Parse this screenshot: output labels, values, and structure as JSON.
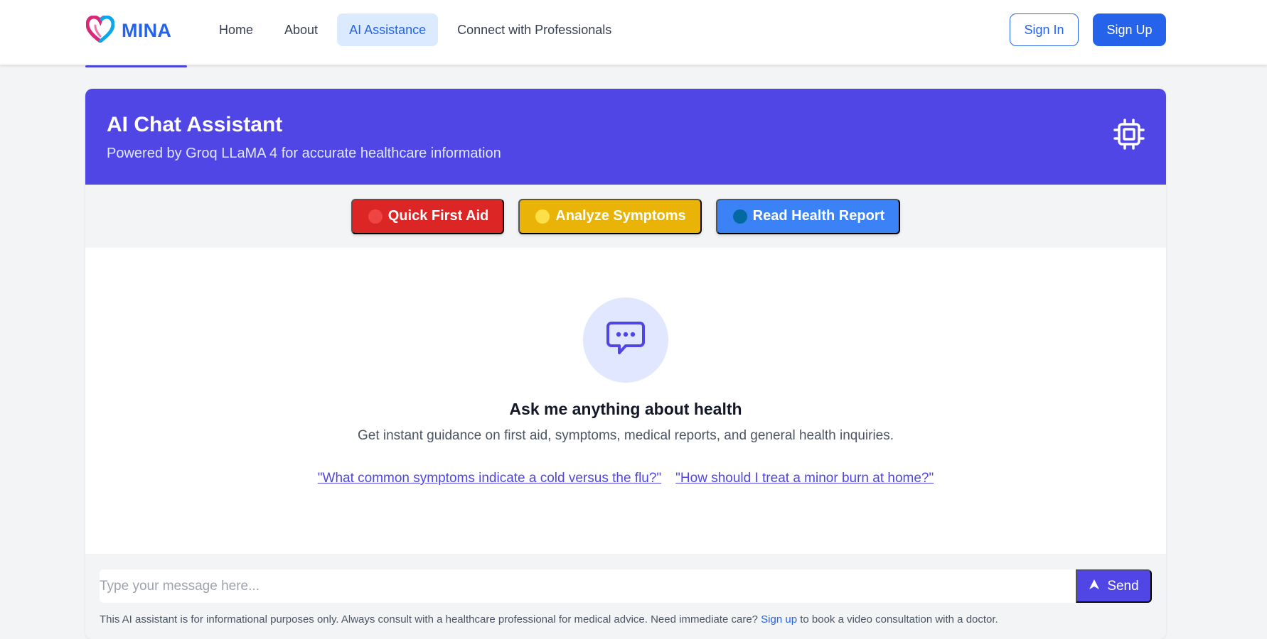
{
  "brand": {
    "name": "MINA",
    "logo_icon": "heart-icon",
    "logo_colors": [
      "#db2777",
      "#0ea5e9"
    ]
  },
  "nav": {
    "items": [
      {
        "label": "Home",
        "active": false
      },
      {
        "label": "About",
        "active": false
      },
      {
        "label": "AI Assistance",
        "active": true
      },
      {
        "label": "Connect with Professionals",
        "active": false
      }
    ],
    "sign_in": "Sign In",
    "sign_up": "Sign Up"
  },
  "assistant": {
    "title": "AI Chat Assistant",
    "subtitle": "Powered by Groq LLaMA 4 for accurate healthcare information",
    "header_icon": "cpu-chip-icon",
    "header_color": "#4f46e5"
  },
  "quick_actions": [
    {
      "label": "Quick First Aid",
      "color": "#dc2626",
      "dot_color": "#ef4444"
    },
    {
      "label": "Analyze Symptoms",
      "color": "#eab308",
      "dot_color": "#fde047"
    },
    {
      "label": "Read Health Report",
      "color": "#3b82f6",
      "dot_color": "#0369a1"
    }
  ],
  "empty_state": {
    "icon": "chat-bubble-icon",
    "title": "Ask me anything about health",
    "description": "Get instant guidance on first aid, symptoms, medical reports, and general health inquiries.",
    "suggestions": [
      "\"What common symptoms indicate a cold versus the flu?\"",
      "\"How should I treat a minor burn at home?\""
    ]
  },
  "composer": {
    "placeholder": "Type your message here...",
    "value": "",
    "send_label": "Send",
    "send_icon": "send-arrow-icon"
  },
  "disclaimer": {
    "before": "This AI assistant is for informational purposes only. Always consult with a healthcare professional for medical advice. Need immediate care? ",
    "link": "Sign up",
    "after": " to book a video consultation with a doctor."
  }
}
